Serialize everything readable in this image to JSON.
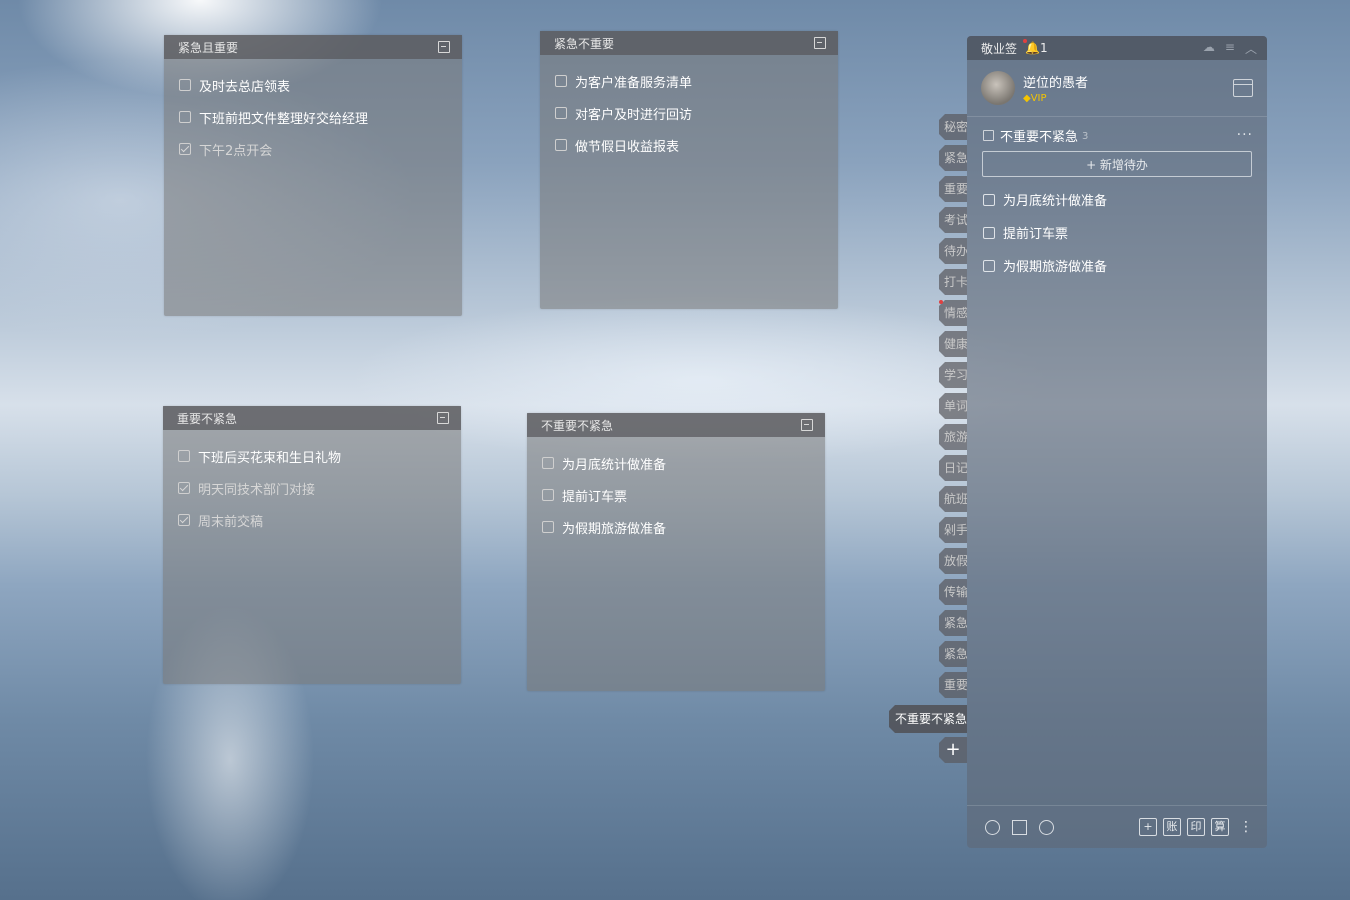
{
  "notes": [
    {
      "title": "紧急且重要",
      "items": [
        {
          "text": "及时去总店领表",
          "done": false
        },
        {
          "text": "下班前把文件整理好交给经理",
          "done": false
        },
        {
          "text": "下午2点开会",
          "done": true
        }
      ]
    },
    {
      "title": "紧急不重要",
      "items": [
        {
          "text": "为客户准备服务清单",
          "done": false
        },
        {
          "text": "对客户及时进行回访",
          "done": false
        },
        {
          "text": "做节假日收益报表",
          "done": false
        }
      ]
    },
    {
      "title": "重要不紧急",
      "items": [
        {
          "text": "下班后买花束和生日礼物",
          "done": false
        },
        {
          "text": "明天同技术部门对接",
          "done": true
        },
        {
          "text": "周末前交稿",
          "done": true
        }
      ]
    },
    {
      "title": "不重要不紧急",
      "items": [
        {
          "text": "为月底统计做准备",
          "done": false
        },
        {
          "text": "提前订车票",
          "done": false
        },
        {
          "text": "为假期旅游做准备",
          "done": false
        }
      ]
    }
  ],
  "side_tabs": [
    "秘密",
    "紧急",
    "重要",
    "考试",
    "待办",
    "打卡",
    "情感",
    "健康",
    "学习",
    "单词",
    "旅游",
    "日记",
    "航班",
    "剁手",
    "放假",
    "传输",
    "紧急",
    "紧急",
    "重要"
  ],
  "active_tab": "不重要不紧急",
  "add_tab": "+",
  "panel": {
    "app_name": "敬业签",
    "notification_count": "1",
    "user_name": "逆位的愚者",
    "vip_label": "VIP",
    "group_title": "不重要不紧急",
    "group_count": "3",
    "more": "···",
    "add_todo": "+ 新增待办",
    "items": [
      "为月底统计做准备",
      "提前订车票",
      "为假期旅游做准备"
    ],
    "footer_buttons": [
      "+",
      "账",
      "印",
      "算"
    ],
    "footer_more": "⋮"
  },
  "colors": {
    "vip": "#f5c400",
    "notification_dot": "#e04040"
  }
}
